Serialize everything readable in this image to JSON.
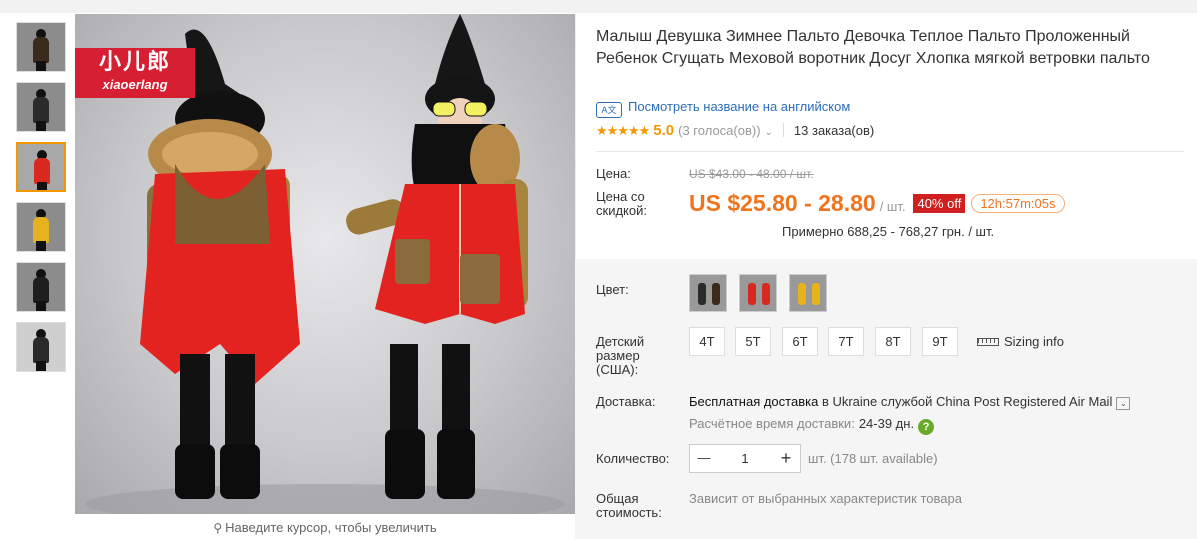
{
  "thumbnails": [
    {
      "name": "thumb-1",
      "coat": "#3a2a1a",
      "active": false
    },
    {
      "name": "thumb-2",
      "coat": "#2b2b2b",
      "active": false
    },
    {
      "name": "thumb-3",
      "coat": "#d8281f",
      "active": true
    },
    {
      "name": "thumb-4",
      "coat": "#e6b21e",
      "active": false
    },
    {
      "name": "thumb-5",
      "coat": "#1e1e1e",
      "active": false
    },
    {
      "name": "thumb-6",
      "coat": "#2a2a2a",
      "active": false
    }
  ],
  "brand": {
    "cn": "小儿郎",
    "en": "xiaoerlang"
  },
  "zoom_hint": "Наведите курсор, чтобы увеличить",
  "product": {
    "title": "Малыш Девушка Зимнее Пальто Девочка Теплое Пальто Проложенный Ребенок Сгущать Меховой воротник Досуг Хлопка мягкой ветровки пальто",
    "translate_link": "Посмотреть название на английском",
    "translate_icon": "A文",
    "stars": "★★★★★",
    "score": "5.0",
    "votes": "(3 голоса(ов))",
    "orders": "13 заказа(ов)"
  },
  "price": {
    "label": "Цена:",
    "old": "US $43.00 - 48.00 / шт.",
    "discount_label": "Цена со скидкой:",
    "new": "US $25.80 - 28.80",
    "unit": "/ шт.",
    "off": "40% off",
    "timer": "12h:57m:05s",
    "approx": "Примерно 688,25 - 768,27 грн. / шт."
  },
  "color": {
    "label": "Цвет:",
    "swatches": [
      {
        "name": "swatch-dark",
        "fig": "#2b2b2b"
      },
      {
        "name": "swatch-red",
        "fig": "#d8281f"
      },
      {
        "name": "swatch-yellow",
        "fig": "#e6b21e"
      }
    ]
  },
  "size": {
    "label": "Детский размер (США):",
    "options": [
      "4T",
      "5T",
      "6T",
      "7T",
      "8T",
      "9T"
    ],
    "sizing_info": "Sizing info"
  },
  "shipping": {
    "label": "Доставка:",
    "free": "Бесплатная доставка",
    "in": "в",
    "country": "Ukraine",
    "by": "службой",
    "carrier": "China Post Registered Air Mail",
    "eta_label": "Расчётное время доставки:",
    "eta_days": "24-39 дн.",
    "help": "?"
  },
  "quantity": {
    "label": "Количество:",
    "value": "1",
    "minus": "—",
    "plus": "+",
    "available": "шт. (178 шт. available)"
  },
  "total": {
    "label": "Общая стоимость:",
    "note": "Зависит от выбранных характеристик товара"
  },
  "colors": {
    "accent": "#f0741e",
    "link": "#2c6fb7",
    "badge": "#d01f1f",
    "star": "#f39800"
  }
}
